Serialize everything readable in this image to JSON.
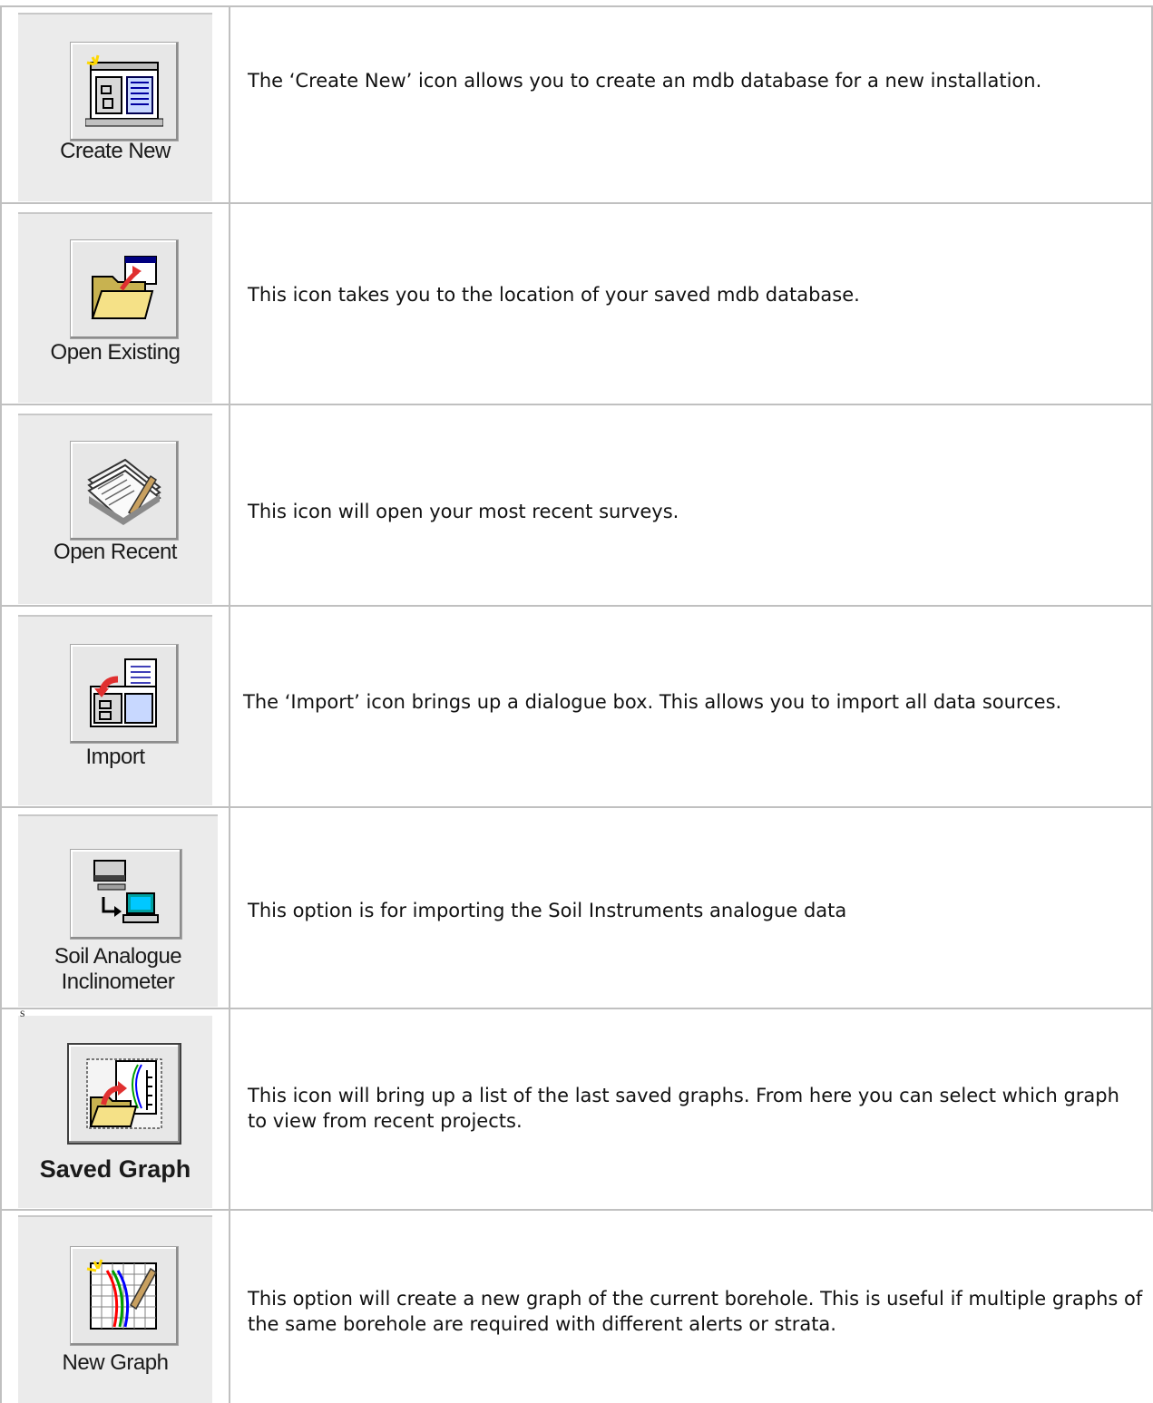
{
  "rows": [
    {
      "label": "Create New",
      "icon": "create-new-icon",
      "description": "The ‘Create New’ icon allows you to create an mdb database for a new installation."
    },
    {
      "label": "Open Existing",
      "icon": "open-existing-icon",
      "description": "This icon takes you to the location of your saved mdb database."
    },
    {
      "label": "Open Recent",
      "icon": "open-recent-icon",
      "description": "This icon will open your most recent surveys."
    },
    {
      "label": "Import",
      "icon": "import-icon",
      "description": "The ‘Import’ icon brings up a dialogue box. This allows you to import all data sources."
    },
    {
      "label_line1": "Soil Analogue",
      "label_line2": "Inclinometer",
      "icon": "soil-analogue-inclinometer-icon",
      "description": "This option is for importing the Soil Instruments analogue data"
    },
    {
      "label": "Saved Graph",
      "icon": "saved-graph-icon",
      "description": "This icon will bring up a list of the last saved graphs. From here you can select which graph to view from recent projects.",
      "corner_mark": "s"
    },
    {
      "label": "New Graph",
      "icon": "new-graph-icon",
      "description": "This option will create a new graph of the current borehole. This is useful if multiple graphs of the same borehole are required with different alerts or strata."
    }
  ],
  "colors": {
    "grid": "#c0c0c0",
    "cell_bg": "#ebebeb"
  }
}
